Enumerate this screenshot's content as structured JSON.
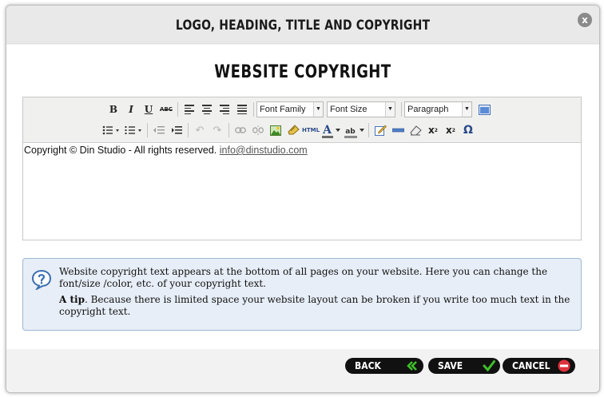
{
  "dialog": {
    "title": "LOGO, HEADING, TITLE AND COPYRIGHT",
    "close_symbol": "x"
  },
  "section": {
    "heading": "WEBSITE COPYRIGHT"
  },
  "toolbar": {
    "row1": {
      "bold": "B",
      "italic": "I",
      "underline": "U",
      "strikethrough": "ABC",
      "font_family": "Font Family",
      "font_size": "Font Size",
      "format": "Paragraph"
    },
    "row2": {
      "html": "HTML",
      "text_color": "A",
      "highlight": "ab",
      "subscript": "x",
      "subscript_mark": "2",
      "superscript": "x",
      "superscript_mark": "2",
      "special_char": "Ω"
    }
  },
  "editor": {
    "text": "Copyright © Din Studio - All rights reserved.",
    "email": "info@dinstudio.com"
  },
  "tip": {
    "line1": "Website copyright text appears at the bottom of all pages on your website. Here you can change the font/size /color, etc. of your copyright text.",
    "tip_label": "A tip",
    "tip_text": ". Because there is limited space your website layout can be broken if you write too much text in the copyright text."
  },
  "buttons": {
    "back": "BACK",
    "save": "SAVE",
    "cancel": "CANCEL"
  },
  "colors": {
    "back_icon": "#3fbf2a",
    "save_icon": "#3fbf2a",
    "cancel_icon": "#e0323c",
    "tip_bg": "#e7eef7",
    "tip_icon": "#3a6fb0"
  },
  "icons": [
    "close-icon",
    "align-left-icon",
    "align-center-icon",
    "align-right-icon",
    "justify-icon",
    "fullscreen-icon",
    "bullet-list-icon",
    "numbered-list-icon",
    "outdent-icon",
    "indent-icon",
    "undo-icon",
    "redo-icon",
    "link-icon",
    "unlink-icon",
    "image-icon",
    "cleanup-icon",
    "edit-icon",
    "hr-icon",
    "eraser-icon",
    "question-bubble-icon",
    "double-chevron-icon",
    "checkmark-icon",
    "no-entry-icon"
  ]
}
